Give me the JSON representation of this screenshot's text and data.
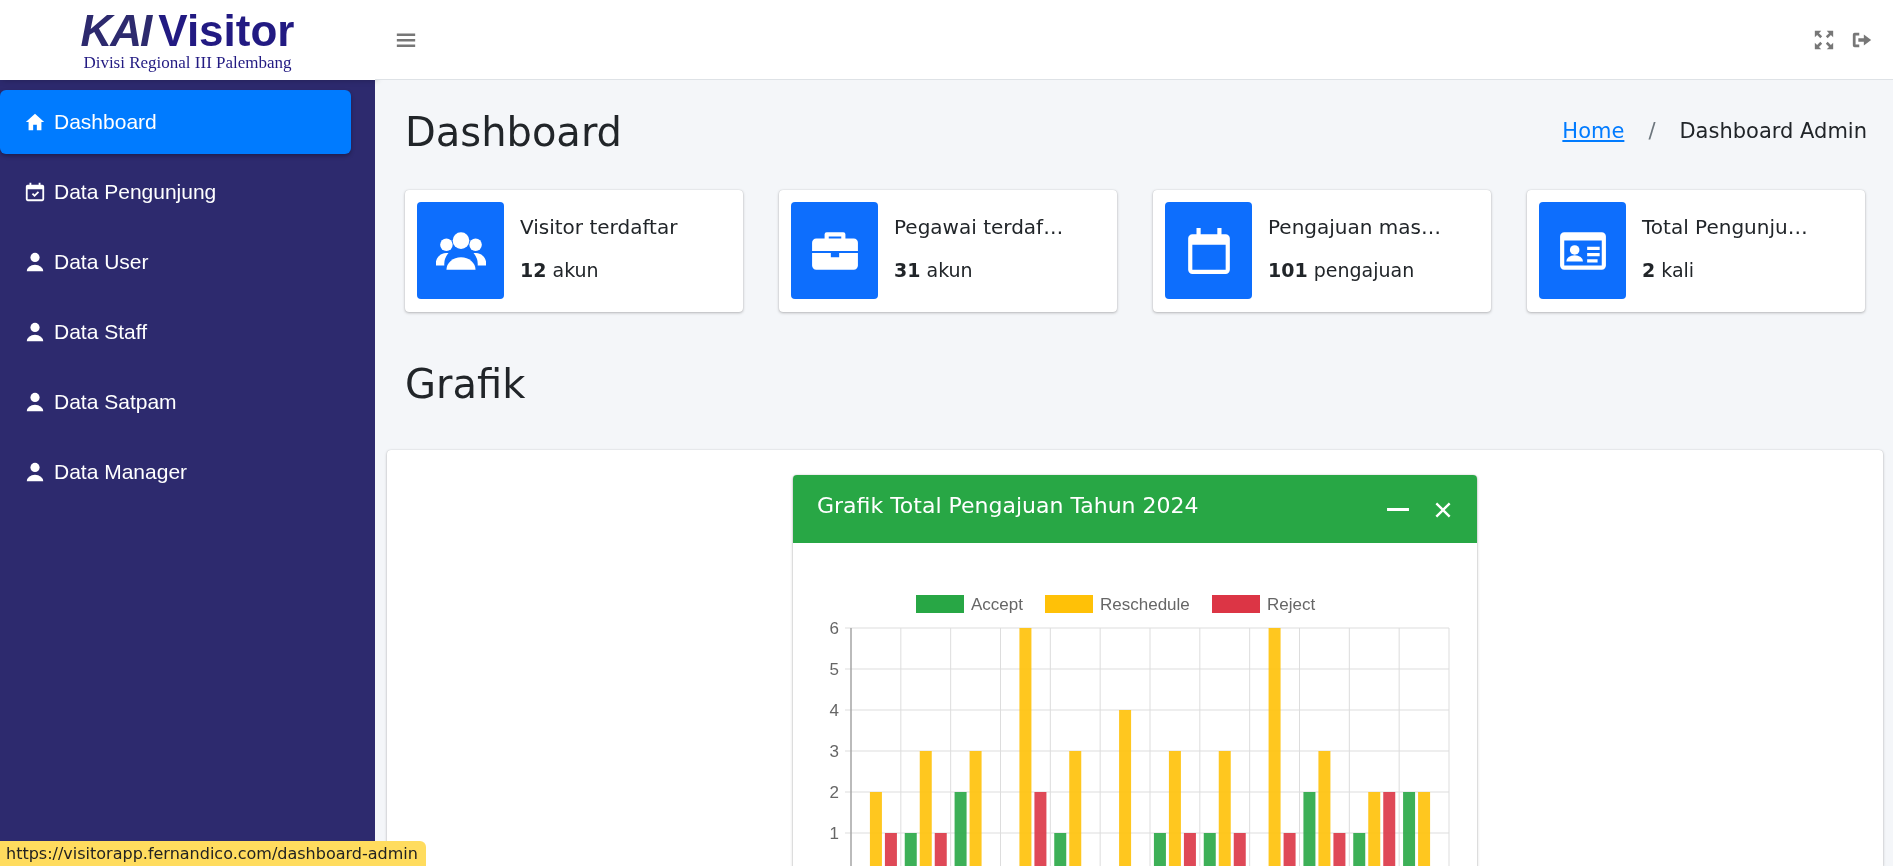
{
  "logo": {
    "brand": "KAI",
    "title": "Visitor",
    "subtitle": "Divisi Regional III Palembang"
  },
  "sidebar": {
    "items": [
      {
        "label": "Dashboard",
        "selected": true
      },
      {
        "label": "Data Pengunjung",
        "selected": false
      },
      {
        "label": "Data User",
        "selected": false
      },
      {
        "label": "Data Staff",
        "selected": false
      },
      {
        "label": "Data Satpam",
        "selected": false
      },
      {
        "label": "Data Manager",
        "selected": false
      }
    ]
  },
  "page": {
    "title": "Dashboard",
    "breadcrumb": [
      {
        "label": "Home",
        "kind": "link"
      },
      {
        "label": "/",
        "kind": "separator"
      },
      {
        "label": "Dashboard Admin",
        "kind": "current"
      }
    ]
  },
  "info_boxes": [
    {
      "label": "Visitor terdaftar",
      "value": "12",
      "unit": "akun"
    },
    {
      "label": "Pegawai terdaf…",
      "value": "31",
      "unit": "akun"
    },
    {
      "label": "Pengajuan mas…",
      "value": "101",
      "unit": "pengajuan"
    },
    {
      "label": "Total Pengunju…",
      "value": "2",
      "unit": "kali"
    }
  ],
  "section_title": "Grafik",
  "chart_card": {
    "title": "Grafik Total Pengajuan Tahun 2024",
    "chart_data": {
      "type": "bar",
      "grid": true,
      "legend": true,
      "ylim": [
        0,
        6
      ],
      "yticks": [
        1,
        2,
        3,
        4,
        5,
        6
      ],
      "series": [
        {
          "name": "Accept",
          "color": "#28a745",
          "values": [
            0,
            1,
            2,
            0,
            1,
            0,
            1,
            1,
            0,
            2,
            1,
            2
          ]
        },
        {
          "name": "Reschedule",
          "color": "#ffc107",
          "values": [
            2,
            3,
            3,
            6,
            3,
            4,
            3,
            3,
            6,
            3,
            2,
            2
          ]
        },
        {
          "name": "Reject",
          "color": "#dc3545",
          "values": [
            1,
            1,
            0,
            2,
            0,
            0,
            1,
            1,
            1,
            1,
            2,
            0
          ]
        }
      ]
    }
  },
  "status_bar": "https://visitorapp.fernandico.com/dashboard-admin"
}
